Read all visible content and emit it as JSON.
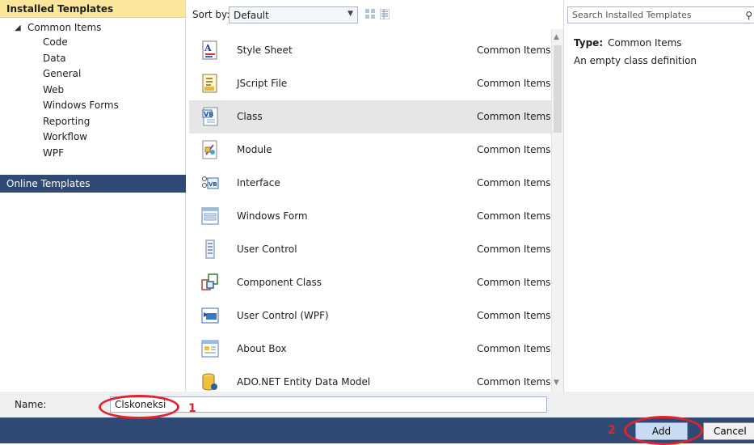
{
  "left": {
    "installed_header": "Installed Templates",
    "root": "Common Items",
    "items": [
      "Code",
      "Data",
      "General",
      "Web",
      "Windows Forms",
      "Reporting",
      "Workflow",
      "WPF"
    ],
    "online_header": "Online Templates"
  },
  "toolbar": {
    "sort_label": "Sort by:",
    "sort_value": "Default"
  },
  "templates": [
    {
      "name": "Style Sheet",
      "category": "Common Items",
      "icon": "stylesheet-icon"
    },
    {
      "name": "JScript File",
      "category": "Common Items",
      "icon": "jscript-icon"
    },
    {
      "name": "Class",
      "category": "Common Items",
      "icon": "vb-class-icon",
      "selected": true
    },
    {
      "name": "Module",
      "category": "Common Items",
      "icon": "module-icon"
    },
    {
      "name": "Interface",
      "category": "Common Items",
      "icon": "interface-icon"
    },
    {
      "name": "Windows Form",
      "category": "Common Items",
      "icon": "windows-form-icon"
    },
    {
      "name": "User Control",
      "category": "Common Items",
      "icon": "user-control-icon"
    },
    {
      "name": "Component Class",
      "category": "Common Items",
      "icon": "component-class-icon"
    },
    {
      "name": "User Control (WPF)",
      "category": "Common Items",
      "icon": "wpf-user-control-icon"
    },
    {
      "name": "About Box",
      "category": "Common Items",
      "icon": "about-box-icon"
    },
    {
      "name": "ADO.NET Entity Data Model",
      "category": "Common Items",
      "icon": "entity-data-model-icon"
    }
  ],
  "right": {
    "search_placeholder": "Search Installed Templates",
    "type_label": "Type:",
    "type_value": "Common Items",
    "description": "An empty class definition"
  },
  "bottom": {
    "name_label": "Name:",
    "name_value": "Clskoneksi",
    "add_label": "Add",
    "cancel_label": "Cancel",
    "annotation_1": "1",
    "annotation_2": "2"
  },
  "colors": {
    "accent_header": "#fbe79c",
    "dark_bar": "#2f4a74",
    "annotation": "#e0232d"
  }
}
